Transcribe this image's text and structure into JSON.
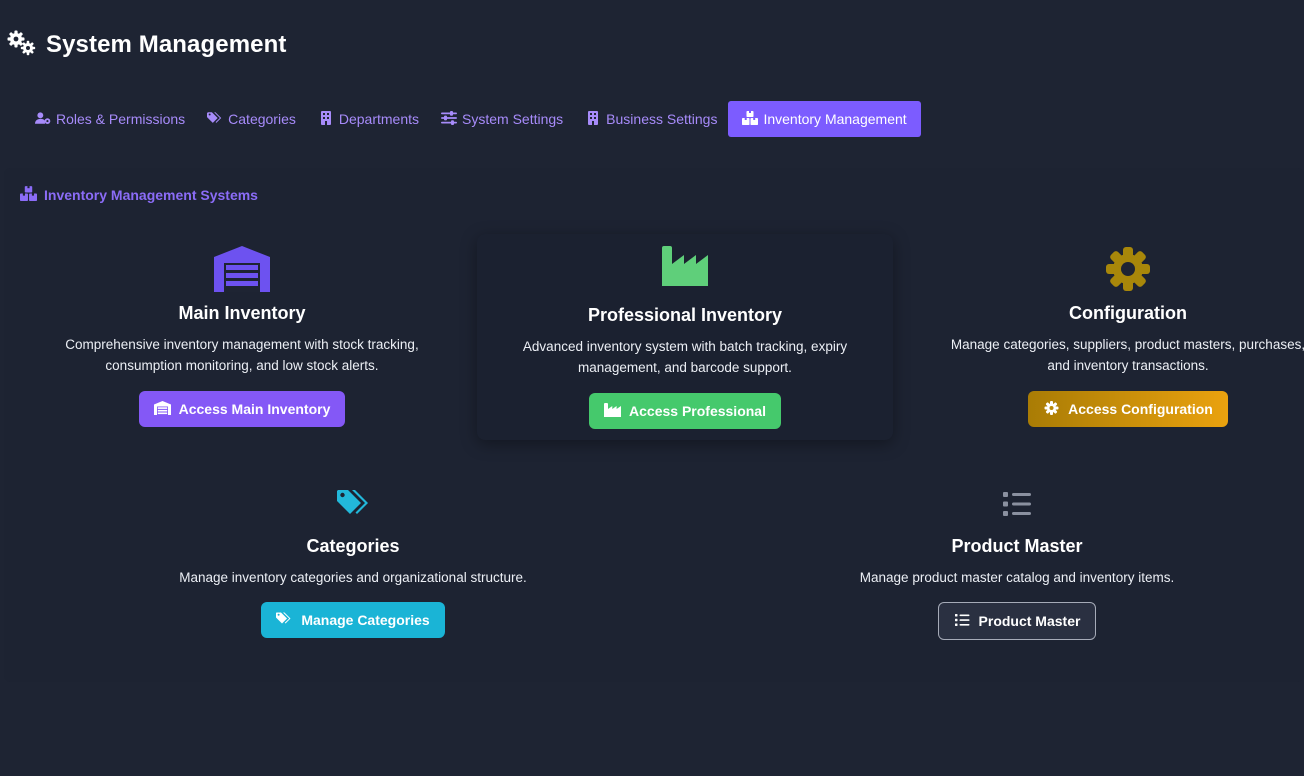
{
  "page": {
    "title": "System Management",
    "icon": "gears-icon"
  },
  "tabs": [
    {
      "label": "Roles & Permissions",
      "icon": "user-gear-icon",
      "active": false
    },
    {
      "label": "Categories",
      "icon": "tags-icon",
      "active": false
    },
    {
      "label": "Departments",
      "icon": "building-icon",
      "active": false
    },
    {
      "label": "System Settings",
      "icon": "sliders-icon",
      "active": false
    },
    {
      "label": "Business Settings",
      "icon": "building-icon",
      "active": false
    },
    {
      "label": "Inventory Management",
      "icon": "boxes-icon",
      "active": true
    }
  ],
  "section": {
    "title": "Inventory Management Systems",
    "icon": "boxes-icon"
  },
  "cards": {
    "main": {
      "icon": "warehouse-icon",
      "title": "Main Inventory",
      "desc_line1": "Comprehensive inventory management with stock tracking,",
      "desc_line2": "consumption monitoring, and low stock alerts.",
      "button": "Access Main Inventory"
    },
    "professional": {
      "icon": "industry-icon",
      "title": "Professional Inventory",
      "desc_line1": "Advanced inventory system with batch tracking, expiry",
      "desc_line2": "management, and barcode support.",
      "button": "Access Professional"
    },
    "configuration": {
      "icon": "gear-icon",
      "title": "Configuration",
      "desc_line1": "Manage categories, suppliers, product masters, purchases,",
      "desc_line2": "and inventory transactions.",
      "button": "Access Configuration"
    },
    "categories": {
      "icon": "tags-icon",
      "title": "Categories",
      "desc_line1": "Manage inventory categories and organizational structure.",
      "button": "Manage Categories"
    },
    "product_master": {
      "icon": "list-icon",
      "title": "Product Master",
      "desc_line1": "Manage product master catalog and inventory items.",
      "button": "Product Master"
    }
  },
  "colors": {
    "accent": "#7c5cff",
    "green": "#45c96c",
    "yellow": "#eaa20f",
    "cyan": "#1ab4d6",
    "background": "#1e2433"
  }
}
